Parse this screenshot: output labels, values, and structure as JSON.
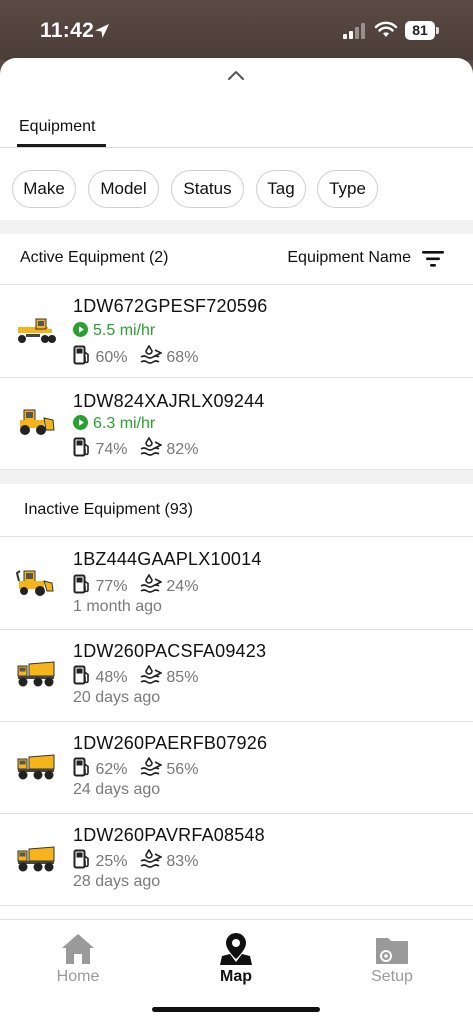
{
  "status": {
    "time": "11:42",
    "battery": "81"
  },
  "tabs": [
    {
      "label": "Equipment"
    }
  ],
  "filters": [
    {
      "label": "Make"
    },
    {
      "label": "Model"
    },
    {
      "label": "Status"
    },
    {
      "label": "Tag"
    },
    {
      "label": "Type"
    }
  ],
  "active": {
    "title": "Active Equipment (2)",
    "sort_label": "Equipment Name",
    "items": [
      {
        "name": "1DW672GPESF720596",
        "speed": "5.5 mi/hr",
        "fuel": "60%",
        "def": "68%",
        "icon": "motor-grader-icon"
      },
      {
        "name": "1DW824XAJRLX09244",
        "speed": "6.3 mi/hr",
        "fuel": "74%",
        "def": "82%",
        "icon": "wheel-loader-icon"
      }
    ]
  },
  "inactive": {
    "title": "Inactive Equipment (93)",
    "items": [
      {
        "name": "1BZ444GAAPLX10014",
        "fuel": "77%",
        "def": "24%",
        "ago": "1 month ago",
        "icon": "backhoe-icon"
      },
      {
        "name": "1DW260PACSFA09423",
        "fuel": "48%",
        "def": "85%",
        "ago": "20 days ago",
        "icon": "articulated-dump-truck-icon"
      },
      {
        "name": "1DW260PAERFB07926",
        "fuel": "62%",
        "def": "56%",
        "ago": "24 days ago",
        "icon": "articulated-dump-truck-icon"
      },
      {
        "name": "1DW260PAVRFA08548",
        "fuel": "25%",
        "def": "83%",
        "ago": "28 days ago",
        "icon": "articulated-dump-truck-icon"
      }
    ]
  },
  "nav": [
    {
      "label": "Home",
      "icon": "home-icon",
      "active": false
    },
    {
      "label": "Map",
      "icon": "map-pin-icon",
      "active": true
    },
    {
      "label": "Setup",
      "icon": "setup-folder-icon",
      "active": false
    }
  ],
  "colors": {
    "accent_green": "#2aa12e",
    "machine_yellow": "#f5b51a",
    "inactive_gray": "#9a9a9a"
  }
}
